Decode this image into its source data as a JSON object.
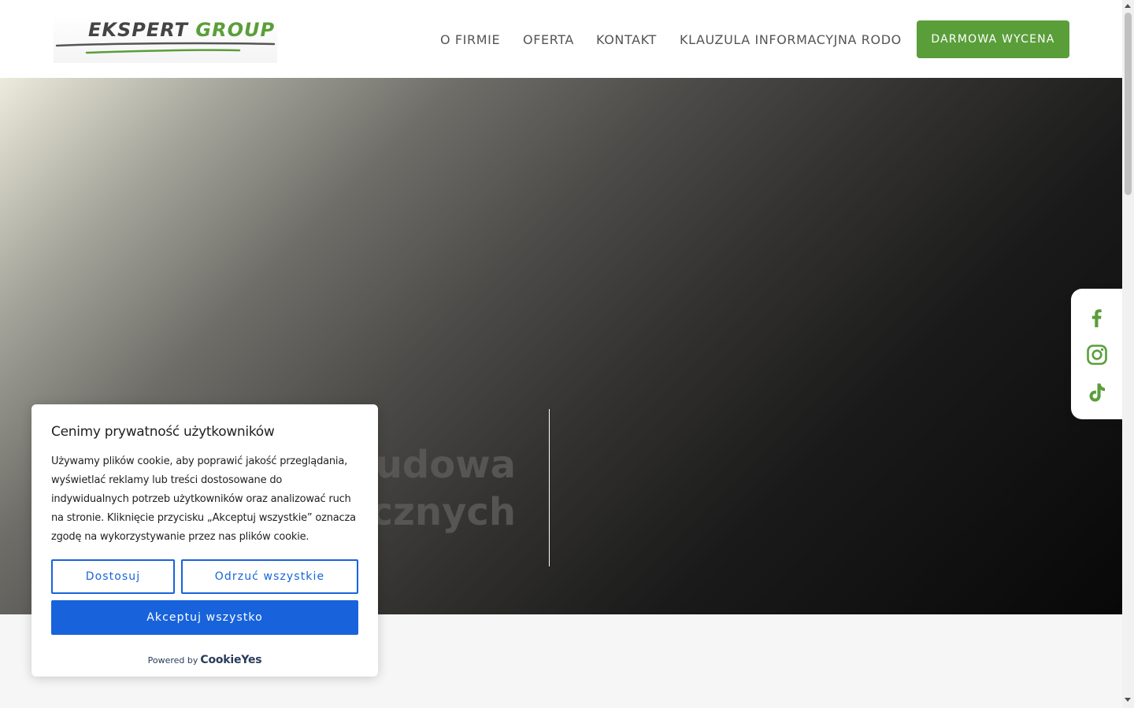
{
  "header": {
    "logo": {
      "word1": "EKSPERT",
      "word2": "GROUP"
    },
    "nav": [
      {
        "label": "O FIRMIE"
      },
      {
        "label": "OFERTA"
      },
      {
        "label": "KONTAKT"
      },
      {
        "label": "KLAUZULA INFORMACYJNA RODO"
      }
    ],
    "cta_label": "DARMOWA WYCENA"
  },
  "hero": {
    "title_line1": "Budowa",
    "title_line2": "icznych"
  },
  "social": [
    {
      "icon": "facebook-icon"
    },
    {
      "icon": "instagram-icon"
    },
    {
      "icon": "tiktok-icon"
    }
  ],
  "cookie": {
    "title": "Cenimy prywatność użytkowników",
    "text": "Używamy plików cookie, aby poprawić jakość przeglądania, wyświetlać reklamy lub treści dostosowane do indywidualnych potrzeb użytkowników oraz analizować ruch na stronie. Kliknięcie przycisku „Akceptuj wszystkie” oznacza zgodę na wykorzystywanie przez nas plików cookie.",
    "customize_label": "Dostosuj",
    "reject_label": "Odrzuć wszystkie",
    "accept_label": "Akceptuj wszystko",
    "powered_by": "Powered by",
    "powered_brand": "CookieYes"
  },
  "colors": {
    "brand_green": "#5a9e3a",
    "cookie_blue": "#1863dc",
    "nav_text": "#555555"
  }
}
